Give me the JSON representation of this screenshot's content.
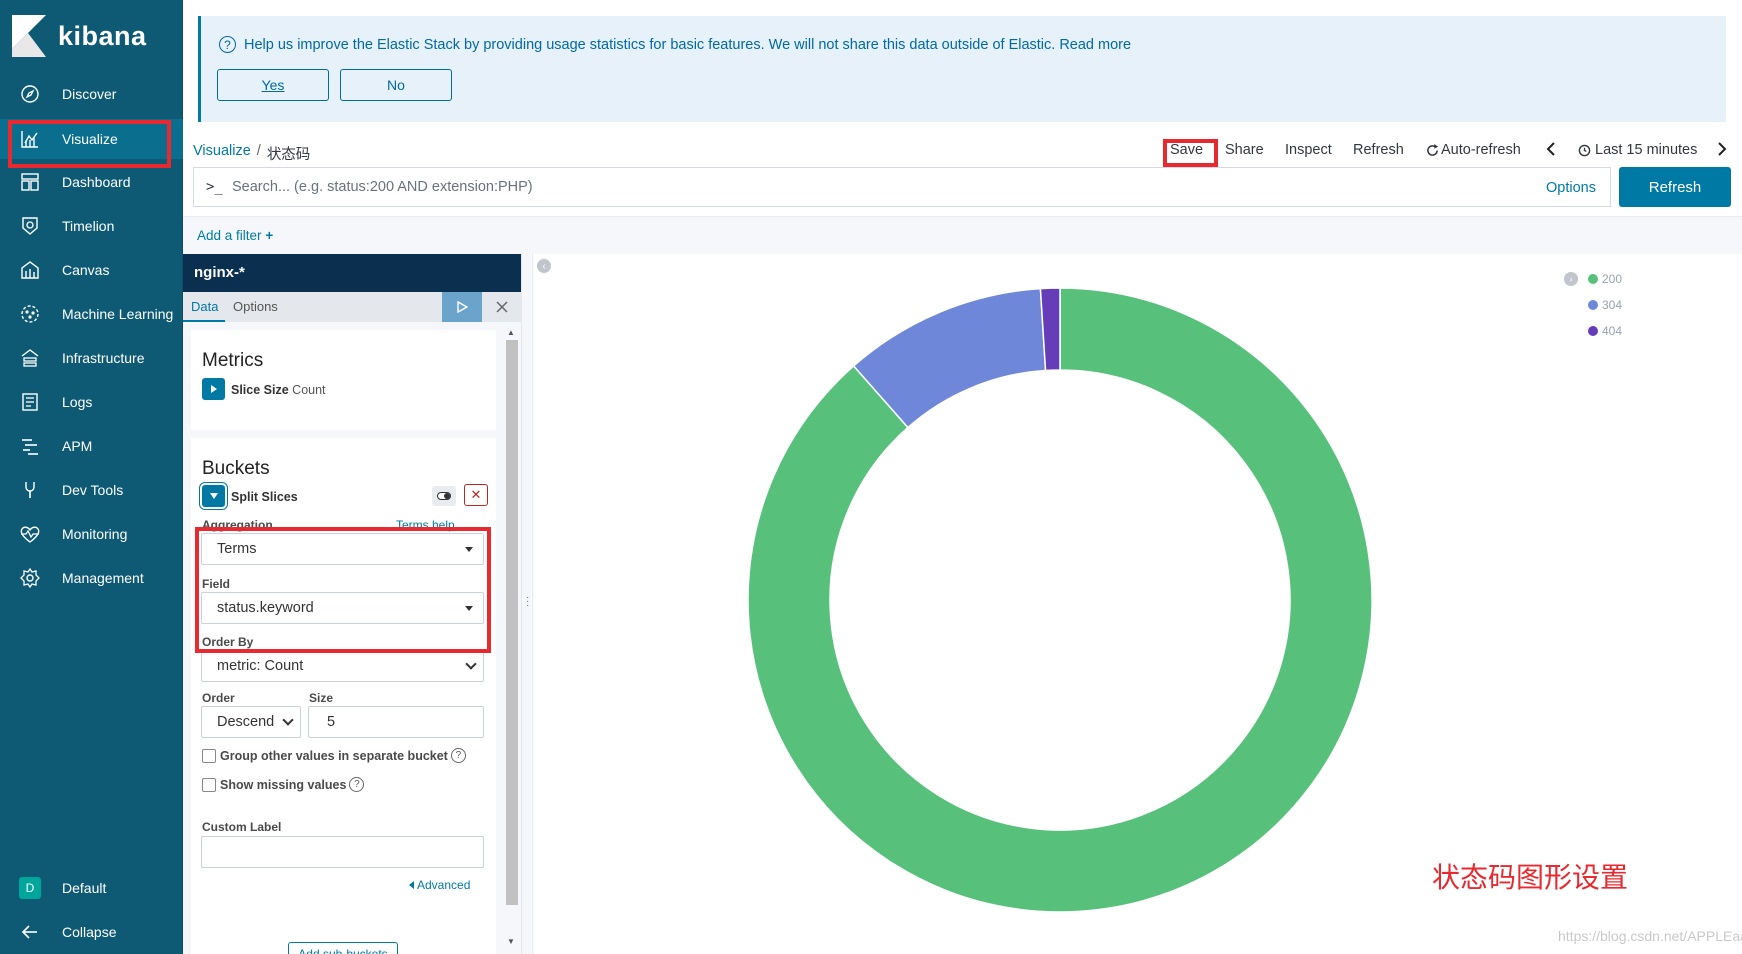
{
  "app": {
    "name": "kibana"
  },
  "sidebar": {
    "items": [
      {
        "label": "Discover",
        "icon": "compass-icon"
      },
      {
        "label": "Visualize",
        "icon": "visualize-icon"
      },
      {
        "label": "Dashboard",
        "icon": "dashboard-icon"
      },
      {
        "label": "Timelion",
        "icon": "timelion-icon"
      },
      {
        "label": "Canvas",
        "icon": "canvas-icon"
      },
      {
        "label": "Machine Learning",
        "icon": "ml-icon"
      },
      {
        "label": "Infrastructure",
        "icon": "infrastructure-icon"
      },
      {
        "label": "Logs",
        "icon": "logs-icon"
      },
      {
        "label": "APM",
        "icon": "apm-icon"
      },
      {
        "label": "Dev Tools",
        "icon": "wrench-icon"
      },
      {
        "label": "Monitoring",
        "icon": "heartbeat-icon"
      },
      {
        "label": "Management",
        "icon": "gear-icon"
      }
    ],
    "space": {
      "avatar": "D",
      "label": "Default"
    },
    "collapse_label": "Collapse"
  },
  "banner": {
    "text": "Help us improve the Elastic Stack by providing usage statistics for basic features. We will not share this data outside of Elastic. Read more",
    "yes_label": "Yes",
    "no_label": "No"
  },
  "breadcrumb": {
    "root": "Visualize",
    "separator": "/",
    "current": "状态码"
  },
  "toolbar": {
    "save": "Save",
    "share": "Share",
    "inspect": "Inspect",
    "refresh": "Refresh",
    "auto_refresh": "Auto-refresh",
    "time_range": "Last 15 minutes"
  },
  "search": {
    "prompt": ">_",
    "placeholder": "Search... (e.g. status:200 AND extension:PHP)",
    "options_label": "Options",
    "refresh_button": "Refresh"
  },
  "filter": {
    "add_label": "Add a filter"
  },
  "editor": {
    "index_pattern": "nginx-*",
    "tabs": {
      "data": "Data",
      "options": "Options"
    },
    "metrics": {
      "title": "Metrics",
      "agg_name": "Slice Size",
      "agg_type": "Count"
    },
    "buckets": {
      "title": "Buckets",
      "agg_name": "Split Slices",
      "aggregation_label": "Aggregation",
      "aggregation_help": "Terms help",
      "aggregation_value": "Terms",
      "field_label": "Field",
      "field_value": "status.keyword",
      "order_by_label": "Order By",
      "order_by_value": "metric: Count",
      "order_label": "Order",
      "order_value": "Descend",
      "size_label": "Size",
      "size_value": "5",
      "group_other_label": "Group other values in separate bucket",
      "show_missing_label": "Show missing values",
      "custom_label_label": "Custom Label",
      "custom_label_value": "",
      "advanced_label": "Advanced",
      "add_sub_buckets": "Add sub-buckets"
    }
  },
  "chart_data": {
    "type": "pie",
    "donut": true,
    "categories": [
      "200",
      "304",
      "404"
    ],
    "values": [
      88.5,
      10.5,
      1.0
    ],
    "colors": [
      "#57c17b",
      "#6f87d8",
      "#663db8"
    ],
    "legend_position": "top-right"
  },
  "annotation": "状态码图形设置",
  "watermark": "https://blog.csdn.net/APPLEaaq"
}
